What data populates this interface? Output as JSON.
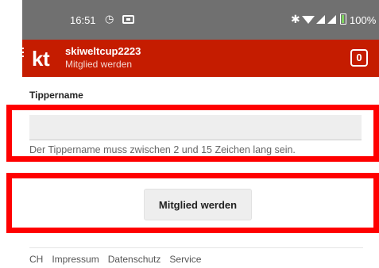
{
  "status_bar": {
    "time": "16:51",
    "battery_percent": "100%",
    "icons": [
      "alarm-icon",
      "screen-icon",
      "bluetooth-icon",
      "wifi-icon",
      "signal-icon",
      "battery-icon"
    ]
  },
  "app_bar": {
    "logo": "kt",
    "title": "skiweltcup2223",
    "subtitle": "Mitglied werden",
    "cart_count": "0",
    "background_color": "#c51c00"
  },
  "form": {
    "field_label": "Tippername",
    "field_value": "",
    "hint": "Der Tippername muss zwischen 2 und 15 Zeichen lang sein.",
    "submit_label": "Mitglied werden"
  },
  "footer": {
    "links": [
      "CH",
      "Impressum",
      "Datenschutz",
      "Service"
    ]
  },
  "highlight_color": "#ff0000"
}
